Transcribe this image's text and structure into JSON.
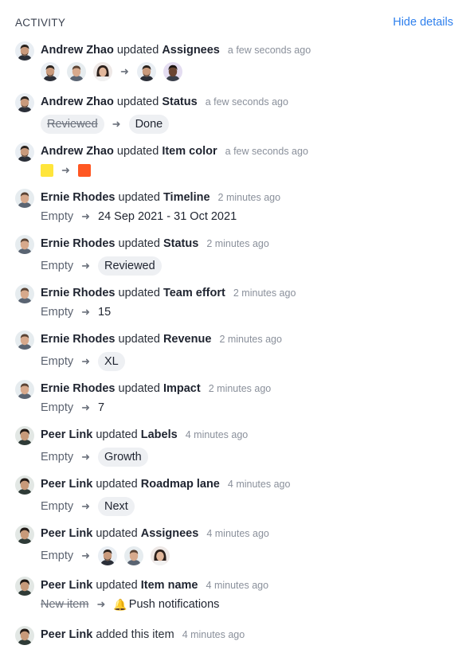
{
  "header": {
    "title": "ACTIVITY",
    "hide_details": "Hide details"
  },
  "colors": {
    "link": "#2f80ed",
    "swatch_from": "#ffe53b",
    "swatch_to": "#ff5722"
  },
  "entries": [
    {
      "name": "Andrew Zhao",
      "verb": "updated",
      "field": "Assignees",
      "time": "a few seconds ago",
      "from_avatars": [
        "andrew",
        "ernie",
        "woman"
      ],
      "to_avatars": [
        "andrew",
        "darkman"
      ]
    },
    {
      "name": "Andrew Zhao",
      "verb": "updated",
      "field": "Status",
      "time": "a few seconds ago",
      "from": "Reviewed",
      "to": "Done"
    },
    {
      "name": "Andrew Zhao",
      "verb": "updated",
      "field": "Item color",
      "time": "a few seconds ago",
      "from_color": "yellow",
      "to_color": "orange"
    },
    {
      "name": "Ernie Rhodes",
      "verb": "updated",
      "field": "Timeline",
      "time": "2 minutes ago",
      "from": "Empty",
      "to": "24 Sep 2021 - 31 Oct 2021"
    },
    {
      "name": "Ernie Rhodes",
      "verb": "updated",
      "field": "Status",
      "time": "2 minutes ago",
      "from": "Empty",
      "to": "Reviewed"
    },
    {
      "name": "Ernie Rhodes",
      "verb": "updated",
      "field": "Team effort",
      "time": "2 minutes ago",
      "from": "Empty",
      "to": "15"
    },
    {
      "name": "Ernie Rhodes",
      "verb": "updated",
      "field": "Revenue",
      "time": "2 minutes ago",
      "from": "Empty",
      "to": "XL"
    },
    {
      "name": "Ernie Rhodes",
      "verb": "updated",
      "field": "Impact",
      "time": "2 minutes ago",
      "from": "Empty",
      "to": "7"
    },
    {
      "name": "Peer Link",
      "verb": "updated",
      "field": "Labels",
      "time": "4 minutes ago",
      "from": "Empty",
      "to": "Growth"
    },
    {
      "name": "Peer Link",
      "verb": "updated",
      "field": "Roadmap lane",
      "time": "4 minutes ago",
      "from": "Empty",
      "to": "Next"
    },
    {
      "name": "Peer Link",
      "verb": "updated",
      "field": "Assignees",
      "time": "4 minutes ago",
      "from": "Empty",
      "to_avatars": [
        "andrew",
        "ernie",
        "woman"
      ]
    },
    {
      "name": "Peer Link",
      "verb": "updated",
      "field": "Item name",
      "time": "4 minutes ago",
      "from": "New item",
      "to_icon": "bell-emoji",
      "to": "Push notifications"
    },
    {
      "name": "Peer Link",
      "verb": "added this item",
      "field": "",
      "time": "4 minutes ago"
    }
  ]
}
